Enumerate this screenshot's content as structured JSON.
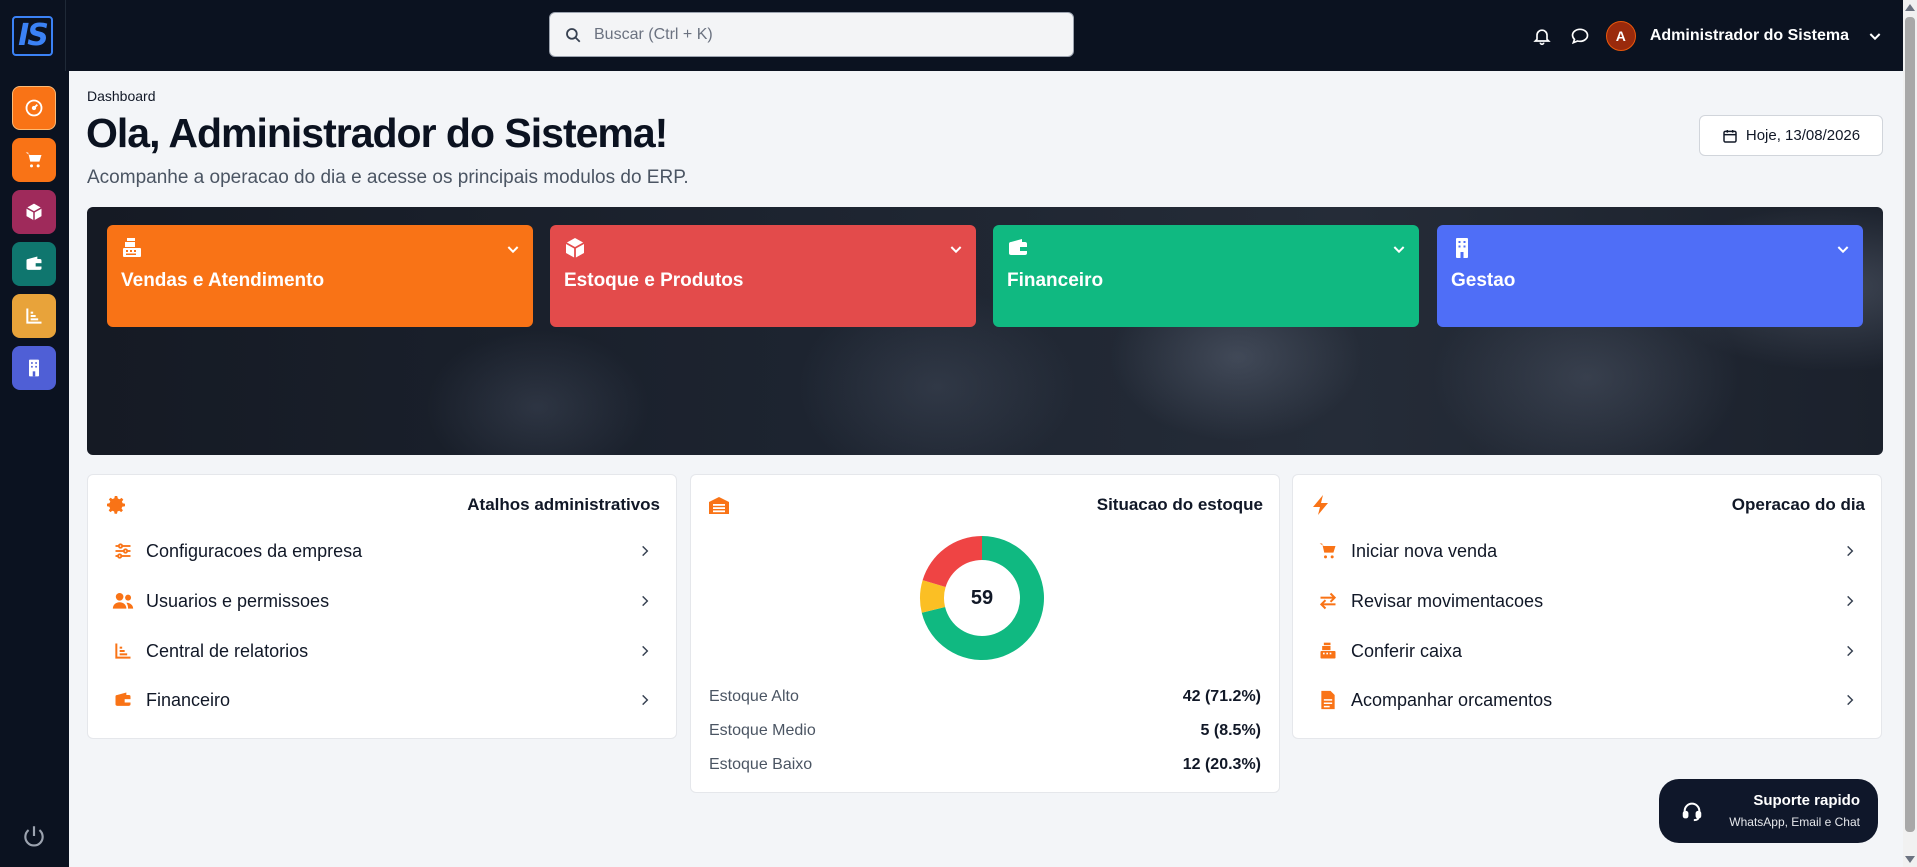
{
  "app": {
    "logo_text": "IS"
  },
  "header": {
    "search_placeholder": "Buscar (Ctrl + K)",
    "user_initial": "A",
    "user_name": "Administrador do Sistema"
  },
  "sidebar": {
    "items": [
      {
        "name": "dashboard",
        "icon": "gauge-icon",
        "color": "#f97316"
      },
      {
        "name": "vendas",
        "icon": "cart-icon",
        "color": "#f97316"
      },
      {
        "name": "estoque",
        "icon": "box-icon",
        "color": "#9f2a5b"
      },
      {
        "name": "financeiro",
        "icon": "wallet-icon",
        "color": "#0f766e"
      },
      {
        "name": "relatorios",
        "icon": "chart-icon",
        "color": "#e8a33a"
      },
      {
        "name": "gestao",
        "icon": "building-icon",
        "color": "#4f5fd6"
      }
    ]
  },
  "page": {
    "breadcrumb": "Dashboard",
    "title": "Ola, Administrador do Sistema!",
    "subtitle": "Acompanhe a operacao do dia e acesse os principais modulos do ERP.",
    "date_label": "Hoje, 13/08/2026"
  },
  "modules": [
    {
      "label": "Vendas e Atendimento",
      "icon": "cash-register-icon",
      "color": "#f97316"
    },
    {
      "label": "Estoque e Produtos",
      "icon": "box-icon",
      "color": "#e34b4b"
    },
    {
      "label": "Financeiro",
      "icon": "wallet-icon",
      "color": "#10b981"
    },
    {
      "label": "Gestao",
      "icon": "building-icon",
      "color": "#4f6ef7"
    }
  ],
  "admin_shortcuts": {
    "title": "Atalhos administrativos",
    "items": [
      {
        "label": "Configuracoes da empresa",
        "icon": "sliders-icon"
      },
      {
        "label": "Usuarios e permissoes",
        "icon": "users-icon"
      },
      {
        "label": "Central de relatorios",
        "icon": "chart-icon"
      },
      {
        "label": "Financeiro",
        "icon": "wallet-icon"
      }
    ]
  },
  "stock": {
    "title": "Situacao do estoque",
    "total": "59",
    "rows": [
      {
        "label": "Estoque Alto",
        "value": "42 (71.2%)"
      },
      {
        "label": "Estoque Medio",
        "value": "5 (8.5%)"
      },
      {
        "label": "Estoque Baixo",
        "value": "12 (20.3%)"
      }
    ]
  },
  "chart_data": {
    "type": "pie",
    "categories": [
      "Estoque Alto",
      "Estoque Medio",
      "Estoque Baixo"
    ],
    "values": [
      42,
      5,
      12
    ],
    "colors": [
      "#10b981",
      "#fbbf24",
      "#ef4444"
    ],
    "center_label": "59"
  },
  "daily_ops": {
    "title": "Operacao do dia",
    "items": [
      {
        "label": "Iniciar nova venda",
        "icon": "cart-icon"
      },
      {
        "label": "Revisar movimentacoes",
        "icon": "arrows-icon"
      },
      {
        "label": "Conferir caixa",
        "icon": "cash-register-icon"
      },
      {
        "label": "Acompanhar orcamentos",
        "icon": "document-icon"
      }
    ]
  },
  "support": {
    "title": "Suporte rapido",
    "subtitle": "WhatsApp, Email e Chat"
  },
  "colors": {
    "accent": "#f97316",
    "dark": "#0b1220"
  }
}
